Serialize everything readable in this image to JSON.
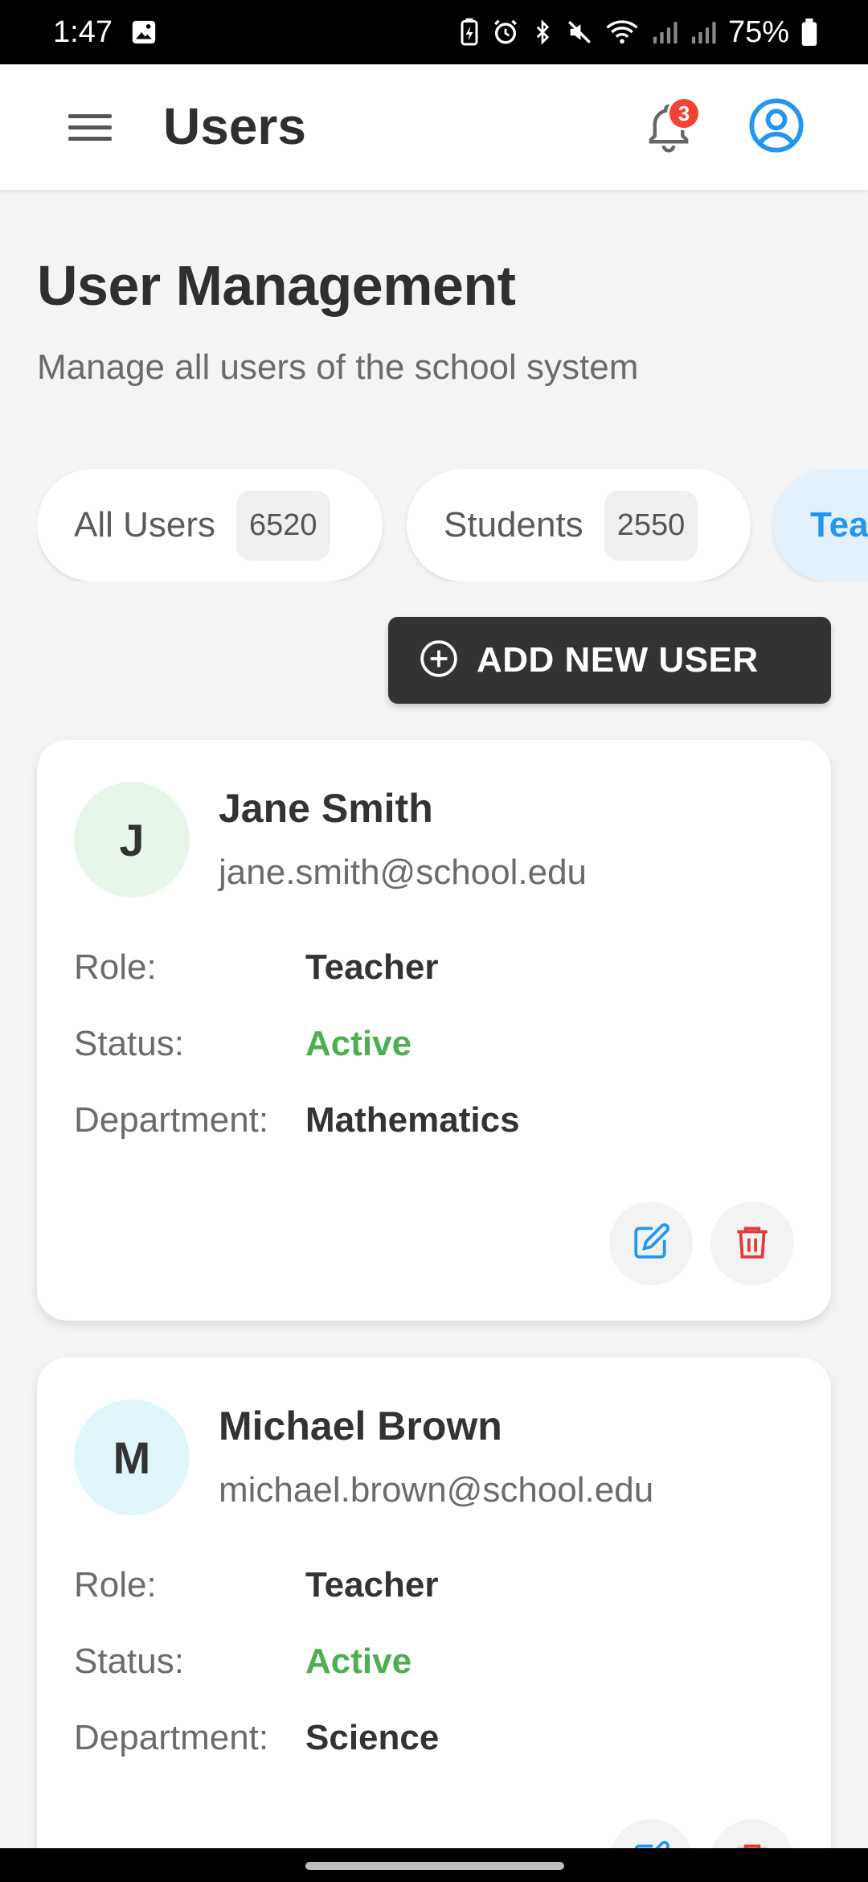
{
  "status_bar": {
    "time": "1:47",
    "battery": "75%"
  },
  "app_bar": {
    "title": "Users",
    "notification_count": "3"
  },
  "page": {
    "title": "User Management",
    "subtitle": "Manage all users of the school system"
  },
  "filters": [
    {
      "label": "All Users",
      "count": "6520"
    },
    {
      "label": "Students",
      "count": "2550"
    },
    {
      "label": "Tea",
      "count": ""
    }
  ],
  "add_button": {
    "label": "ADD NEW USER"
  },
  "field_labels": {
    "role": "Role:",
    "status": "Status:",
    "department": "Department:"
  },
  "users": [
    {
      "initial": "J",
      "name": "Jane Smith",
      "email": "jane.smith@school.edu",
      "role": "Teacher",
      "status": "Active",
      "department": "Mathematics",
      "avatar_color": "#e8f5e9"
    },
    {
      "initial": "M",
      "name": "Michael Brown",
      "email": "michael.brown@school.edu",
      "role": "Teacher",
      "status": "Active",
      "department": "Science",
      "avatar_color": "#e0f6fa"
    }
  ],
  "colors": {
    "accent": "#2196f3",
    "danger": "#e53935",
    "active_status": "#4caf50",
    "badge": "#f44336"
  },
  "icons": [
    "menu-icon",
    "bell-icon",
    "account-circle-icon",
    "add-circle-icon",
    "edit-icon",
    "delete-icon"
  ]
}
